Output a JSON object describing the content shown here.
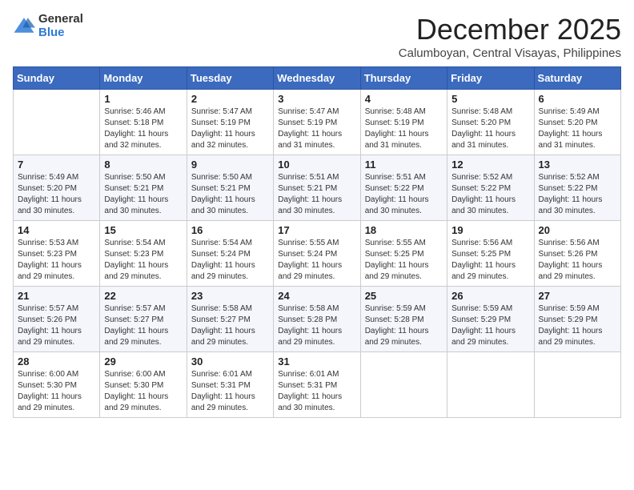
{
  "logo": {
    "general": "General",
    "blue": "Blue"
  },
  "title": "December 2025",
  "location": "Calumboyan, Central Visayas, Philippines",
  "headers": [
    "Sunday",
    "Monday",
    "Tuesday",
    "Wednesday",
    "Thursday",
    "Friday",
    "Saturday"
  ],
  "rows": [
    [
      {
        "day": "",
        "sunrise": "",
        "sunset": "",
        "daylight": ""
      },
      {
        "day": "1",
        "sunrise": "Sunrise: 5:46 AM",
        "sunset": "Sunset: 5:18 PM",
        "daylight": "Daylight: 11 hours and 32 minutes."
      },
      {
        "day": "2",
        "sunrise": "Sunrise: 5:47 AM",
        "sunset": "Sunset: 5:19 PM",
        "daylight": "Daylight: 11 hours and 32 minutes."
      },
      {
        "day": "3",
        "sunrise": "Sunrise: 5:47 AM",
        "sunset": "Sunset: 5:19 PM",
        "daylight": "Daylight: 11 hours and 31 minutes."
      },
      {
        "day": "4",
        "sunrise": "Sunrise: 5:48 AM",
        "sunset": "Sunset: 5:19 PM",
        "daylight": "Daylight: 11 hours and 31 minutes."
      },
      {
        "day": "5",
        "sunrise": "Sunrise: 5:48 AM",
        "sunset": "Sunset: 5:20 PM",
        "daylight": "Daylight: 11 hours and 31 minutes."
      },
      {
        "day": "6",
        "sunrise": "Sunrise: 5:49 AM",
        "sunset": "Sunset: 5:20 PM",
        "daylight": "Daylight: 11 hours and 31 minutes."
      }
    ],
    [
      {
        "day": "7",
        "sunrise": "Sunrise: 5:49 AM",
        "sunset": "Sunset: 5:20 PM",
        "daylight": "Daylight: 11 hours and 30 minutes."
      },
      {
        "day": "8",
        "sunrise": "Sunrise: 5:50 AM",
        "sunset": "Sunset: 5:21 PM",
        "daylight": "Daylight: 11 hours and 30 minutes."
      },
      {
        "day": "9",
        "sunrise": "Sunrise: 5:50 AM",
        "sunset": "Sunset: 5:21 PM",
        "daylight": "Daylight: 11 hours and 30 minutes."
      },
      {
        "day": "10",
        "sunrise": "Sunrise: 5:51 AM",
        "sunset": "Sunset: 5:21 PM",
        "daylight": "Daylight: 11 hours and 30 minutes."
      },
      {
        "day": "11",
        "sunrise": "Sunrise: 5:51 AM",
        "sunset": "Sunset: 5:22 PM",
        "daylight": "Daylight: 11 hours and 30 minutes."
      },
      {
        "day": "12",
        "sunrise": "Sunrise: 5:52 AM",
        "sunset": "Sunset: 5:22 PM",
        "daylight": "Daylight: 11 hours and 30 minutes."
      },
      {
        "day": "13",
        "sunrise": "Sunrise: 5:52 AM",
        "sunset": "Sunset: 5:22 PM",
        "daylight": "Daylight: 11 hours and 30 minutes."
      }
    ],
    [
      {
        "day": "14",
        "sunrise": "Sunrise: 5:53 AM",
        "sunset": "Sunset: 5:23 PM",
        "daylight": "Daylight: 11 hours and 29 minutes."
      },
      {
        "day": "15",
        "sunrise": "Sunrise: 5:54 AM",
        "sunset": "Sunset: 5:23 PM",
        "daylight": "Daylight: 11 hours and 29 minutes."
      },
      {
        "day": "16",
        "sunrise": "Sunrise: 5:54 AM",
        "sunset": "Sunset: 5:24 PM",
        "daylight": "Daylight: 11 hours and 29 minutes."
      },
      {
        "day": "17",
        "sunrise": "Sunrise: 5:55 AM",
        "sunset": "Sunset: 5:24 PM",
        "daylight": "Daylight: 11 hours and 29 minutes."
      },
      {
        "day": "18",
        "sunrise": "Sunrise: 5:55 AM",
        "sunset": "Sunset: 5:25 PM",
        "daylight": "Daylight: 11 hours and 29 minutes."
      },
      {
        "day": "19",
        "sunrise": "Sunrise: 5:56 AM",
        "sunset": "Sunset: 5:25 PM",
        "daylight": "Daylight: 11 hours and 29 minutes."
      },
      {
        "day": "20",
        "sunrise": "Sunrise: 5:56 AM",
        "sunset": "Sunset: 5:26 PM",
        "daylight": "Daylight: 11 hours and 29 minutes."
      }
    ],
    [
      {
        "day": "21",
        "sunrise": "Sunrise: 5:57 AM",
        "sunset": "Sunset: 5:26 PM",
        "daylight": "Daylight: 11 hours and 29 minutes."
      },
      {
        "day": "22",
        "sunrise": "Sunrise: 5:57 AM",
        "sunset": "Sunset: 5:27 PM",
        "daylight": "Daylight: 11 hours and 29 minutes."
      },
      {
        "day": "23",
        "sunrise": "Sunrise: 5:58 AM",
        "sunset": "Sunset: 5:27 PM",
        "daylight": "Daylight: 11 hours and 29 minutes."
      },
      {
        "day": "24",
        "sunrise": "Sunrise: 5:58 AM",
        "sunset": "Sunset: 5:28 PM",
        "daylight": "Daylight: 11 hours and 29 minutes."
      },
      {
        "day": "25",
        "sunrise": "Sunrise: 5:59 AM",
        "sunset": "Sunset: 5:28 PM",
        "daylight": "Daylight: 11 hours and 29 minutes."
      },
      {
        "day": "26",
        "sunrise": "Sunrise: 5:59 AM",
        "sunset": "Sunset: 5:29 PM",
        "daylight": "Daylight: 11 hours and 29 minutes."
      },
      {
        "day": "27",
        "sunrise": "Sunrise: 5:59 AM",
        "sunset": "Sunset: 5:29 PM",
        "daylight": "Daylight: 11 hours and 29 minutes."
      }
    ],
    [
      {
        "day": "28",
        "sunrise": "Sunrise: 6:00 AM",
        "sunset": "Sunset: 5:30 PM",
        "daylight": "Daylight: 11 hours and 29 minutes."
      },
      {
        "day": "29",
        "sunrise": "Sunrise: 6:00 AM",
        "sunset": "Sunset: 5:30 PM",
        "daylight": "Daylight: 11 hours and 29 minutes."
      },
      {
        "day": "30",
        "sunrise": "Sunrise: 6:01 AM",
        "sunset": "Sunset: 5:31 PM",
        "daylight": "Daylight: 11 hours and 29 minutes."
      },
      {
        "day": "31",
        "sunrise": "Sunrise: 6:01 AM",
        "sunset": "Sunset: 5:31 PM",
        "daylight": "Daylight: 11 hours and 30 minutes."
      },
      {
        "day": "",
        "sunrise": "",
        "sunset": "",
        "daylight": ""
      },
      {
        "day": "",
        "sunrise": "",
        "sunset": "",
        "daylight": ""
      },
      {
        "day": "",
        "sunrise": "",
        "sunset": "",
        "daylight": ""
      }
    ]
  ]
}
